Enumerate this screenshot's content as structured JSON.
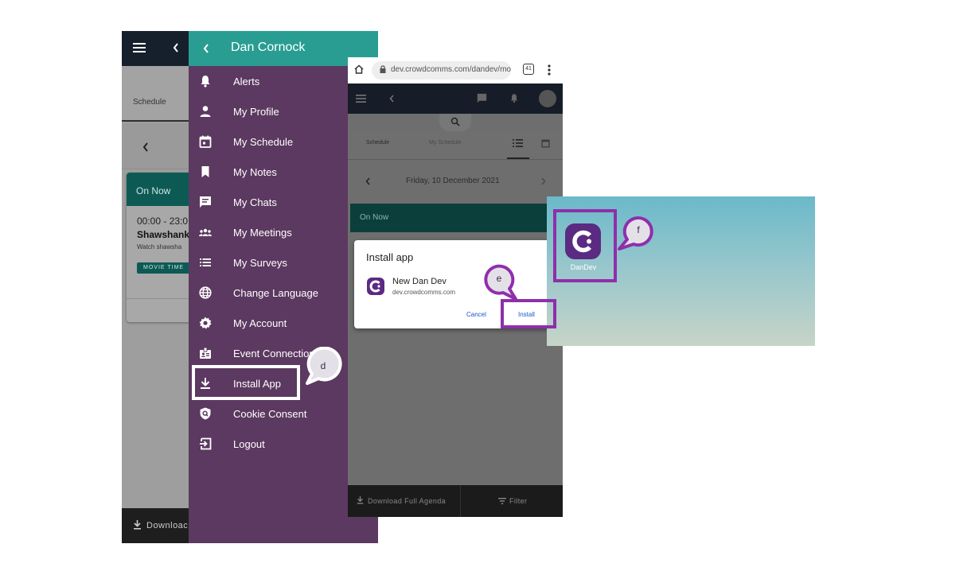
{
  "phone1": {
    "tabs": {
      "schedule": "Schedule"
    },
    "card": {
      "status": "On Now",
      "time": "00:00 - 23:0",
      "title": "Shawshank",
      "description": "Watch shawsha",
      "tag": "MOVIE TIME"
    },
    "bottom_label": "Downloac"
  },
  "drawer": {
    "title": "Dan Cornock",
    "items": [
      {
        "label": "Alerts",
        "icon": "bell-icon"
      },
      {
        "label": "My Profile",
        "icon": "person-icon"
      },
      {
        "label": "My Schedule",
        "icon": "calendar-icon"
      },
      {
        "label": "My Notes",
        "icon": "bookmark-icon"
      },
      {
        "label": "My Chats",
        "icon": "chat-icon"
      },
      {
        "label": "My Meetings",
        "icon": "group-icon"
      },
      {
        "label": "My Surveys",
        "icon": "list-icon"
      },
      {
        "label": "Change Language",
        "icon": "globe-icon"
      },
      {
        "label": "My Account",
        "icon": "gear-icon"
      },
      {
        "label": "Event Connection",
        "icon": "badge-icon"
      },
      {
        "label": "Install App",
        "icon": "download-icon"
      },
      {
        "label": "Cookie Consent",
        "icon": "shield-icon"
      },
      {
        "label": "Logout",
        "icon": "logout-icon"
      }
    ]
  },
  "phone2": {
    "url": "dev.crowdcomms.com/dandev/mo",
    "tab_count": "41",
    "tabs": {
      "schedule": "Schedule",
      "my_schedule": "My Schedule"
    },
    "date": "Friday, 10 December 2021",
    "card_status": "On Now",
    "bottom": {
      "download": "Download Full Agenda",
      "filter": "Filter"
    }
  },
  "dialog": {
    "title": "Install app",
    "app_name": "New Dan Dev",
    "app_domain": "dev.crowdcomms.com",
    "cancel_label": "Cancel",
    "install_label": "Install"
  },
  "desktop": {
    "icon_label": "DanDev"
  },
  "callouts": {
    "d": "d",
    "e": "e",
    "f": "f"
  },
  "colors": {
    "drawer_bg": "#5c3960",
    "drawer_header": "#2a9d93",
    "highlight_purple": "#8e2fab",
    "app_brand": "#5b2a82"
  }
}
